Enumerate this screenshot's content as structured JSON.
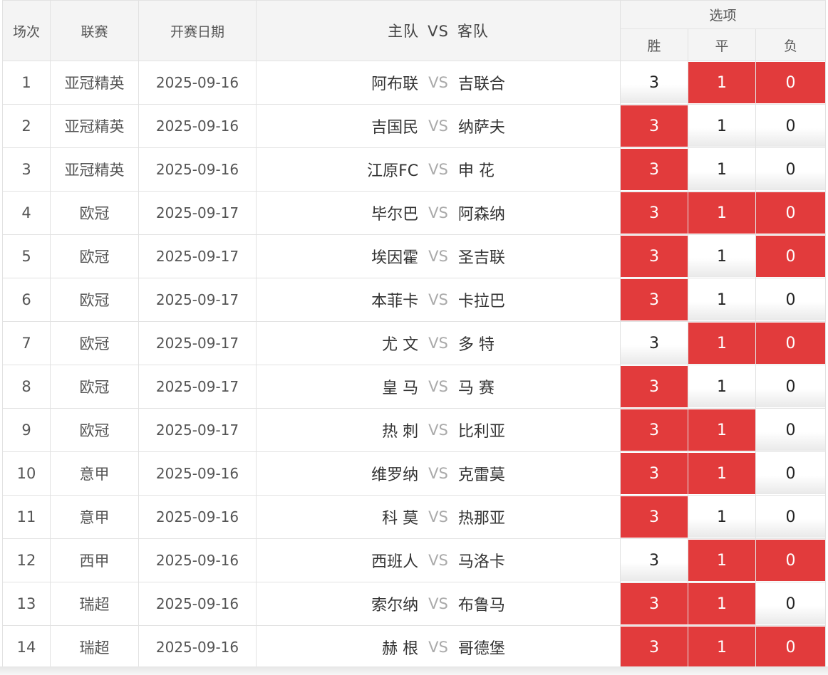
{
  "header": {
    "round": "场次",
    "league": "联赛",
    "date": "开赛日期",
    "home": "主队",
    "vs": "VS",
    "away": "客队",
    "options": "选项",
    "win": "胜",
    "draw": "平",
    "lose": "负"
  },
  "option_labels": {
    "win": "3",
    "draw": "1",
    "lose": "0"
  },
  "colors": {
    "selected": "#e23b3c",
    "header_bg": "#f4f4f4",
    "border": "#e2e2e2"
  },
  "rows": [
    {
      "no": "1",
      "league": "亚冠精英",
      "date": "2025-09-16",
      "home": "阿布联",
      "vs": "VS",
      "away": "吉联合",
      "sel": {
        "win": false,
        "draw": true,
        "lose": true
      }
    },
    {
      "no": "2",
      "league": "亚冠精英",
      "date": "2025-09-16",
      "home": "吉国民",
      "vs": "VS",
      "away": "纳萨夫",
      "sel": {
        "win": true,
        "draw": false,
        "lose": false
      }
    },
    {
      "no": "3",
      "league": "亚冠精英",
      "date": "2025-09-16",
      "home": "江原FC",
      "vs": "VS",
      "away": "申 花",
      "sel": {
        "win": true,
        "draw": false,
        "lose": false
      }
    },
    {
      "no": "4",
      "league": "欧冠",
      "date": "2025-09-17",
      "home": "毕尔巴",
      "vs": "VS",
      "away": "阿森纳",
      "sel": {
        "win": true,
        "draw": true,
        "lose": true
      }
    },
    {
      "no": "5",
      "league": "欧冠",
      "date": "2025-09-17",
      "home": "埃因霍",
      "vs": "VS",
      "away": "圣吉联",
      "sel": {
        "win": true,
        "draw": false,
        "lose": true
      }
    },
    {
      "no": "6",
      "league": "欧冠",
      "date": "2025-09-17",
      "home": "本菲卡",
      "vs": "VS",
      "away": "卡拉巴",
      "sel": {
        "win": true,
        "draw": false,
        "lose": false
      }
    },
    {
      "no": "7",
      "league": "欧冠",
      "date": "2025-09-17",
      "home": "尤 文",
      "vs": "VS",
      "away": "多 特",
      "sel": {
        "win": false,
        "draw": true,
        "lose": true
      }
    },
    {
      "no": "8",
      "league": "欧冠",
      "date": "2025-09-17",
      "home": "皇 马",
      "vs": "VS",
      "away": "马 赛",
      "sel": {
        "win": true,
        "draw": false,
        "lose": false
      }
    },
    {
      "no": "9",
      "league": "欧冠",
      "date": "2025-09-17",
      "home": "热 刺",
      "vs": "VS",
      "away": "比利亚",
      "sel": {
        "win": true,
        "draw": true,
        "lose": false
      }
    },
    {
      "no": "10",
      "league": "意甲",
      "date": "2025-09-16",
      "home": "维罗纳",
      "vs": "VS",
      "away": "克雷莫",
      "sel": {
        "win": true,
        "draw": true,
        "lose": false
      }
    },
    {
      "no": "11",
      "league": "意甲",
      "date": "2025-09-16",
      "home": "科 莫",
      "vs": "VS",
      "away": "热那亚",
      "sel": {
        "win": true,
        "draw": false,
        "lose": false
      }
    },
    {
      "no": "12",
      "league": "西甲",
      "date": "2025-09-16",
      "home": "西班人",
      "vs": "VS",
      "away": "马洛卡",
      "sel": {
        "win": false,
        "draw": true,
        "lose": true
      }
    },
    {
      "no": "13",
      "league": "瑞超",
      "date": "2025-09-16",
      "home": "索尔纳",
      "vs": "VS",
      "away": "布鲁马",
      "sel": {
        "win": true,
        "draw": true,
        "lose": false
      }
    },
    {
      "no": "14",
      "league": "瑞超",
      "date": "2025-09-16",
      "home": "赫 根",
      "vs": "VS",
      "away": "哥德堡",
      "sel": {
        "win": true,
        "draw": true,
        "lose": true
      }
    }
  ]
}
